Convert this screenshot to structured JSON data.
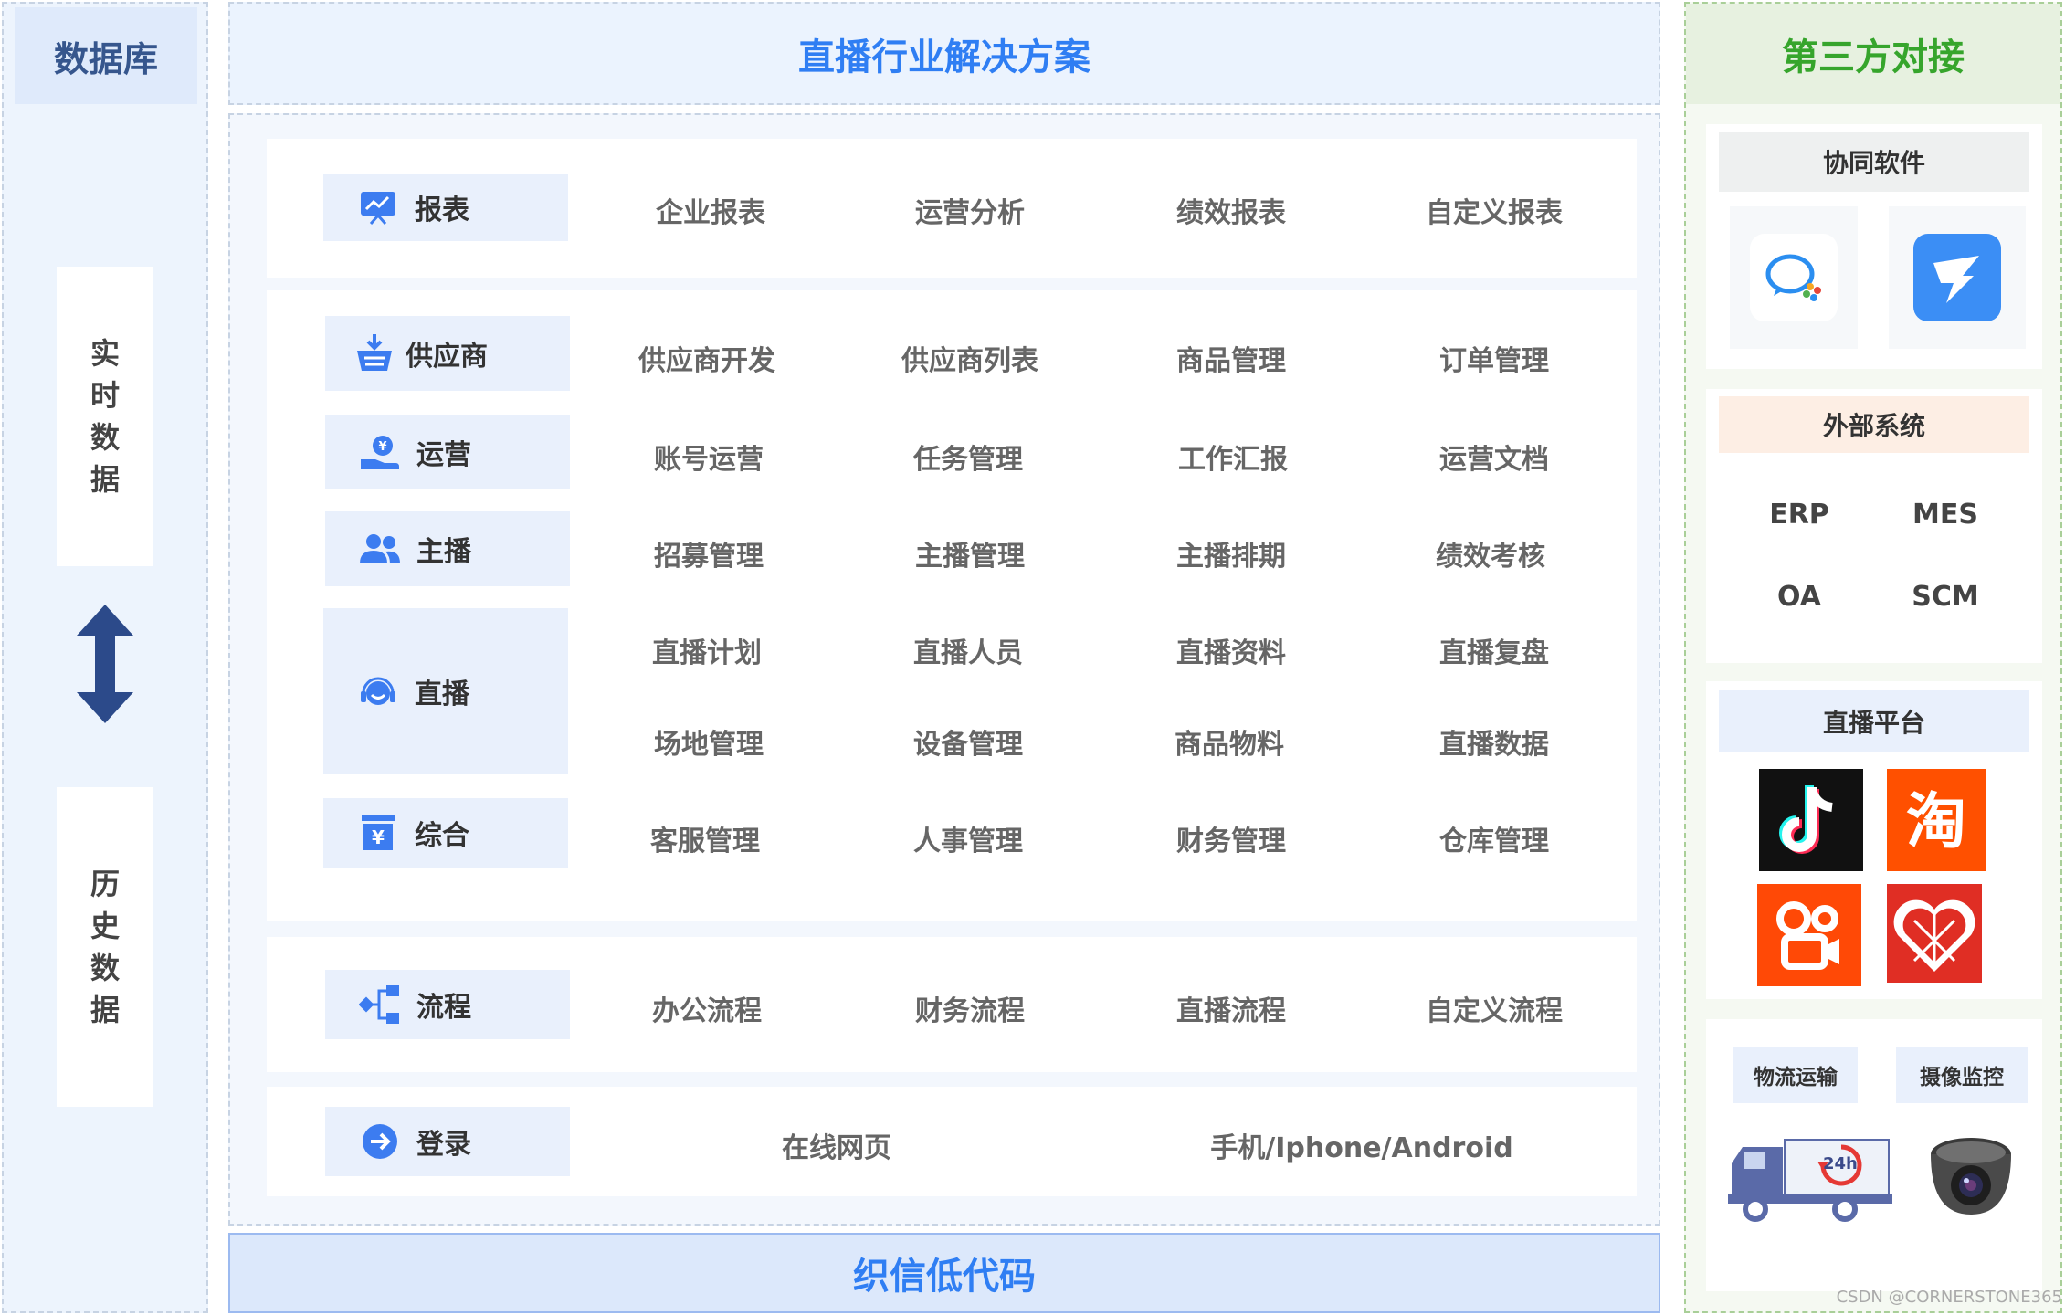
{
  "database": {
    "title": "数据库",
    "realtime": [
      "实",
      "时",
      "数",
      "据"
    ],
    "history": [
      "历",
      "史",
      "数",
      "据"
    ]
  },
  "center": {
    "title": "直播行业解决方案",
    "footer": "织信低代码",
    "report": {
      "label": "报表",
      "items": [
        "企业报表",
        "运营分析",
        "绩效报表",
        "自定义报表"
      ]
    },
    "supplier": {
      "label": "供应商",
      "items": [
        "供应商开发",
        "供应商列表",
        "商品管理",
        "订单管理"
      ]
    },
    "operation": {
      "label": "运营",
      "items": [
        "账号运营",
        "任务管理",
        "工作汇报",
        "运营文档"
      ]
    },
    "anchor": {
      "label": "主播",
      "items": [
        "招募管理",
        "主播管理",
        "主播排期",
        "绩效考核"
      ]
    },
    "live": {
      "label": "直播",
      "items": [
        "直播计划",
        "直播人员",
        "直播资料",
        "直播复盘",
        "场地管理",
        "设备管理",
        "商品物料",
        "直播数据"
      ]
    },
    "general": {
      "label": "综合",
      "items": [
        "客服管理",
        "人事管理",
        "财务管理",
        "仓库管理"
      ]
    },
    "process": {
      "label": "流程",
      "items": [
        "办公流程",
        "财务流程",
        "直播流程",
        "自定义流程"
      ]
    },
    "login": {
      "label": "登录",
      "items": [
        "在线网页",
        "手机/Iphone/Android"
      ]
    }
  },
  "third_party": {
    "title": "第三方对接",
    "collab": {
      "title": "协同软件",
      "icons": [
        "wecom-icon",
        "dingtalk-icon"
      ]
    },
    "external": {
      "title": "外部系统",
      "systems": [
        "ERP",
        "MES",
        "OA",
        "SCM"
      ]
    },
    "live_platform": {
      "title": "直播平台",
      "icons": [
        "douyin-icon",
        "taobao-icon",
        "kuaishou-icon",
        "pinduoduo-icon"
      ]
    },
    "logistics": {
      "label": "物流运输",
      "badge": "24h"
    },
    "camera": {
      "label": "摄像监控"
    }
  },
  "watermark": "CSDN @CORNERSTONE365",
  "colors": {
    "accent_blue": "#2f7ef3",
    "accent_green": "#36a52c",
    "label_bg": "#e9f0fc",
    "db_title": "#36568d"
  }
}
